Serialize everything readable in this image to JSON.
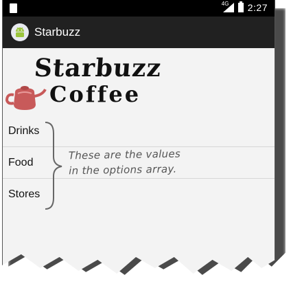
{
  "status_bar": {
    "network": "4G",
    "time": "2:27"
  },
  "action_bar": {
    "app_icon": "android-icon",
    "title": "Starbuzz"
  },
  "logo": {
    "line1": "Starbuzz",
    "line2": "Coffee",
    "icon": "teapot-icon"
  },
  "options": [
    {
      "label": "Drinks"
    },
    {
      "label": "Food"
    },
    {
      "label": "Stores"
    }
  ],
  "annotation": {
    "line1": "These are the values",
    "line2": "in the options array."
  }
}
